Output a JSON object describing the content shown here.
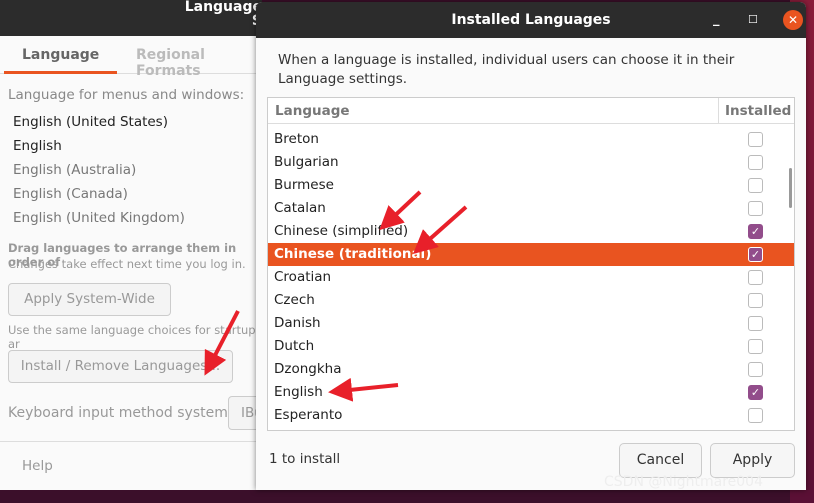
{
  "back_window": {
    "title": "Language S",
    "tabs": [
      "Language",
      "Regional Formats"
    ],
    "section_label": "Language for menus and windows:",
    "languages": [
      "English (United States)",
      "English",
      "English (Australia)",
      "English (Canada)",
      "English (United Kingdom)"
    ],
    "drag_hint": "Drag languages to arrange them in order of",
    "changes_hint": "Changes take effect next time you log in.",
    "apply_button": "Apply System-Wide",
    "same_choices": "Use the same language choices for startup ar",
    "install_button": "Install / Remove Languages...",
    "keyboard_label": "Keyboard input method system:",
    "keyboard_value": "IBu",
    "help_button": "Help"
  },
  "dialog": {
    "title": "Installed Languages",
    "description": "When a language is installed, individual users can choose it in their Language settings.",
    "columns": [
      "Language",
      "Installed"
    ],
    "rows": [
      {
        "name": "Breton",
        "installed": false
      },
      {
        "name": "Bulgarian",
        "installed": false
      },
      {
        "name": "Burmese",
        "installed": false
      },
      {
        "name": "Catalan",
        "installed": false
      },
      {
        "name": "Chinese (simplified)",
        "installed": true
      },
      {
        "name": "Chinese (traditional)",
        "installed": true,
        "selected": true
      },
      {
        "name": "Croatian",
        "installed": false
      },
      {
        "name": "Czech",
        "installed": false
      },
      {
        "name": "Danish",
        "installed": false
      },
      {
        "name": "Dutch",
        "installed": false
      },
      {
        "name": "Dzongkha",
        "installed": false
      },
      {
        "name": "English",
        "installed": true
      },
      {
        "name": "Esperanto",
        "installed": false
      }
    ],
    "status": "1 to install",
    "cancel_button": "Cancel",
    "apply_button": "Apply",
    "window_controls": {
      "minimize": "_",
      "maximize": "☐",
      "close": "✕"
    }
  },
  "watermark": "CSDN @Nightmare004",
  "colors": {
    "accent": "#e95420",
    "checkbox": "#924d8b",
    "annotation_arrow": "#e8202a"
  }
}
